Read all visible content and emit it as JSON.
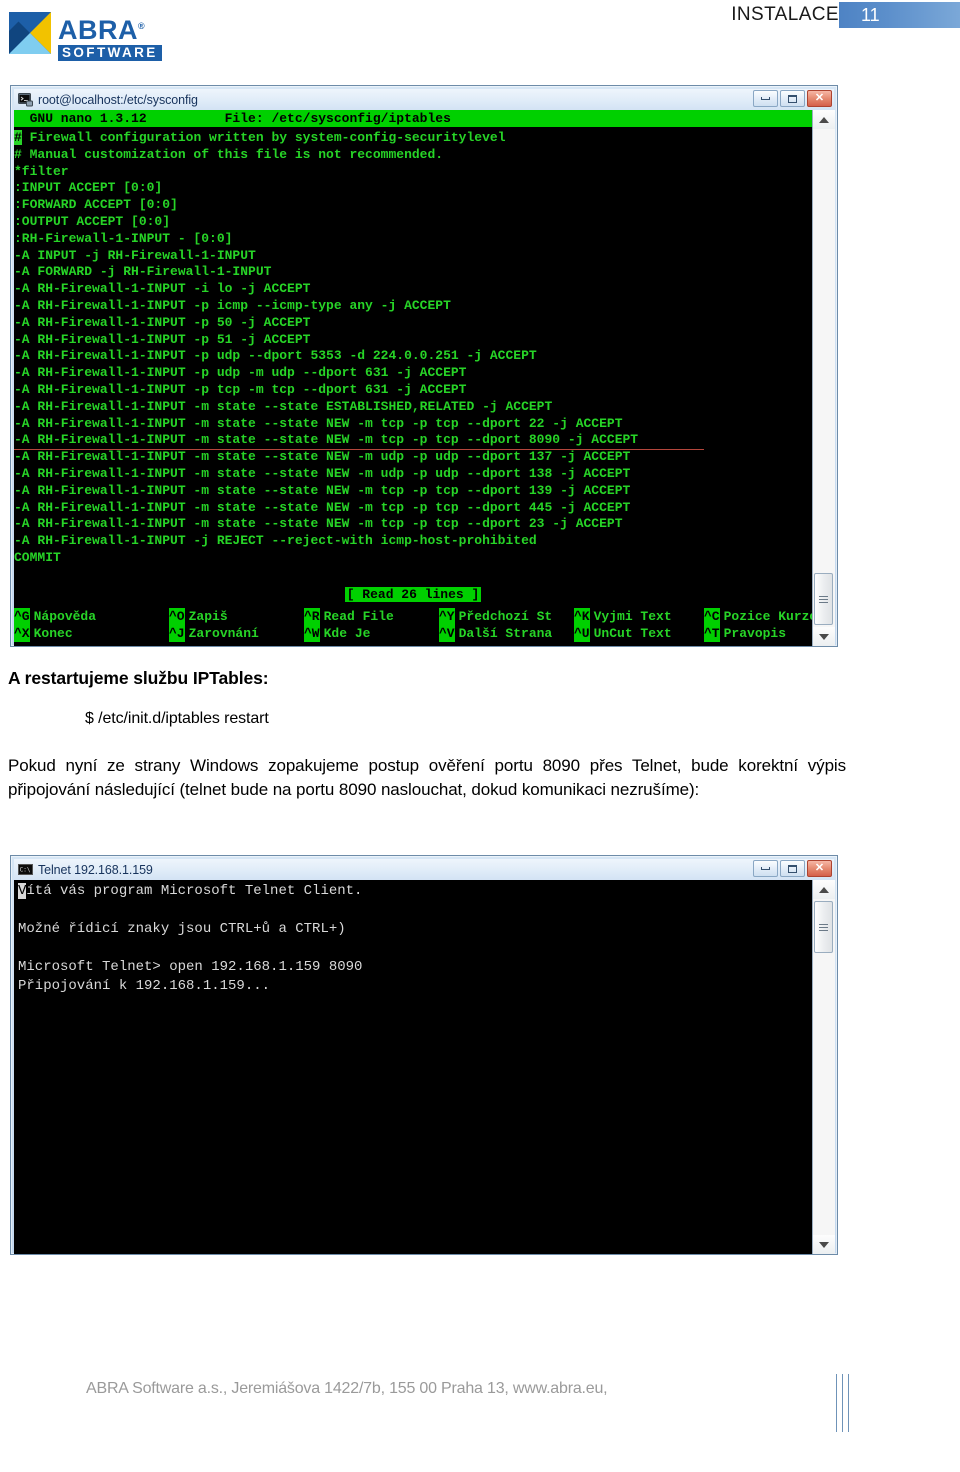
{
  "header": {
    "brand_name": "ABRA",
    "brand_sub": "SOFTWARE",
    "brand_reg": "®",
    "section_title": "INSTALACE",
    "page_number": "11",
    "badge_color": "#5c8fcb",
    "brand_color": "#1d5fa8"
  },
  "terminal_window": {
    "title": "root@localhost:/etc/sysconfig",
    "icon": "terminal-icon",
    "buttons": {
      "minimize": "minimize-icon",
      "maximize": "maximize-icon",
      "close": "✕"
    },
    "nano": {
      "header_left": "  GNU nano 1.3.12",
      "header_right": "File: /etc/sysconfig/iptables",
      "header_line": "  GNU nano 1.3.12          File: /etc/sysconfig/iptables",
      "cursor_char": "#",
      "lines": [
        " Firewall configuration written by system-config-securitylevel",
        "# Manual customization of this file is not recommended.",
        "*filter",
        ":INPUT ACCEPT [0:0]",
        ":FORWARD ACCEPT [0:0]",
        ":OUTPUT ACCEPT [0:0]",
        ":RH-Firewall-1-INPUT - [0:0]",
        "-A INPUT -j RH-Firewall-1-INPUT",
        "-A FORWARD -j RH-Firewall-1-INPUT",
        "-A RH-Firewall-1-INPUT -i lo -j ACCEPT",
        "-A RH-Firewall-1-INPUT -p icmp --icmp-type any -j ACCEPT",
        "-A RH-Firewall-1-INPUT -p 50 -j ACCEPT",
        "-A RH-Firewall-1-INPUT -p 51 -j ACCEPT",
        "-A RH-Firewall-1-INPUT -p udp --dport 5353 -d 224.0.0.251 -j ACCEPT",
        "-A RH-Firewall-1-INPUT -p udp -m udp --dport 631 -j ACCEPT",
        "-A RH-Firewall-1-INPUT -p tcp -m tcp --dport 631 -j ACCEPT",
        "-A RH-Firewall-1-INPUT -m state --state ESTABLISHED,RELATED -j ACCEPT",
        "-A RH-Firewall-1-INPUT -m state --state NEW -m tcp -p tcp --dport 22 -j ACCEPT",
        "-A RH-Firewall-1-INPUT -m state --state NEW -m tcp -p tcp --dport 8090 -j ACCEPT",
        "-A RH-Firewall-1-INPUT -m state --state NEW -m udp -p udp --dport 137 -j ACCEPT",
        "-A RH-Firewall-1-INPUT -m state --state NEW -m udp -p udp --dport 138 -j ACCEPT",
        "-A RH-Firewall-1-INPUT -m state --state NEW -m tcp -p tcp --dport 139 -j ACCEPT",
        "-A RH-Firewall-1-INPUT -m state --state NEW -m tcp -p tcp --dport 445 -j ACCEPT",
        "-A RH-Firewall-1-INPUT -m state --state NEW -m tcp -p tcp --dport 23 -j ACCEPT",
        "-A RH-Firewall-1-INPUT -j REJECT --reject-with icmp-host-prohibited",
        "COMMIT"
      ],
      "highlight_line_index": 18,
      "highlight_color": "#b4463c",
      "status_message": "[ Read 26 lines ]",
      "shortcuts_row1": [
        {
          "key": "^G",
          "label": "Nápověda"
        },
        {
          "key": "^O",
          "label": "Zapiš"
        },
        {
          "key": "^R",
          "label": "Read File"
        },
        {
          "key": "^Y",
          "label": "Předchozí St"
        },
        {
          "key": "^K",
          "label": "Vyjmi Text"
        },
        {
          "key": "^C",
          "label": "Pozice Kurzoru"
        }
      ],
      "shortcuts_row2": [
        {
          "key": "^X",
          "label": "Konec"
        },
        {
          "key": "^J",
          "label": "Zarovnání"
        },
        {
          "key": "^W",
          "label": "Kde Je"
        },
        {
          "key": "^V",
          "label": "Další Strana"
        },
        {
          "key": "^U",
          "label": "UnCut Text"
        },
        {
          "key": "^T",
          "label": "Pravopis"
        }
      ]
    }
  },
  "body": {
    "restart_heading": "A restartujeme službu IPTables:",
    "restart_command": "$ /etc/init.d/iptables restart",
    "paragraph": "Pokud nyní ze strany Windows zopakujeme postup ověření portu 8090 přes Telnet, bude korektní výpis připojování následující (telnet bude na portu 8090 naslouchat, dokud komunikaci nezrušíme):"
  },
  "telnet_window": {
    "title": "Telnet 192.168.1.159",
    "icon": "console-icon",
    "buttons": {
      "minimize": "minimize-icon",
      "maximize": "maximize-icon",
      "close": "✕"
    },
    "lines": [
      "Vítá vás program Microsoft Telnet Client.",
      "",
      "Možné řídicí znaky jsou CTRL+ů a CTRL+)",
      "",
      "Microsoft Telnet> open 192.168.1.159 8090",
      "Připojování k 192.168.1.159..."
    ]
  },
  "footer": {
    "text": "ABRA Software a.s., Jeremiášova 1422/7b, 155 00 Praha 13, www.abra.eu,"
  }
}
